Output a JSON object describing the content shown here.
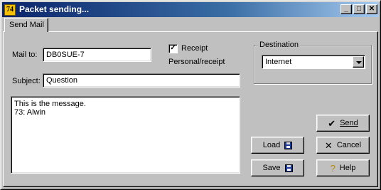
{
  "window": {
    "title": "Packet sending...",
    "app_icon_text": "74"
  },
  "titlebar_buttons": {
    "minimize": "_",
    "maximize": "□",
    "close": "✕"
  },
  "tabs": [
    {
      "label": "Send Mail"
    }
  ],
  "form": {
    "mail_to": {
      "label": "Mail to:",
      "value": "DB0SUE-7"
    },
    "subject": {
      "label": "Subject:",
      "value": "Question"
    },
    "message": {
      "value": "This is the message.\n73: Alwin"
    },
    "receipt": {
      "label": "Receipt",
      "checked": true,
      "check_mark": "✓"
    },
    "personal_receipt": {
      "label": "Personal/receipt"
    }
  },
  "destination": {
    "group_label": "Destination",
    "selected": "Internet"
  },
  "buttons": {
    "send": "Send",
    "cancel": "Cancel",
    "load": "Load",
    "save": "Save",
    "help": "Help"
  },
  "icons": {
    "send": "checkmark-icon",
    "cancel": "x-icon",
    "load": "floppy-disk-icon",
    "save": "floppy-disk-icon",
    "help": "question-icon"
  }
}
